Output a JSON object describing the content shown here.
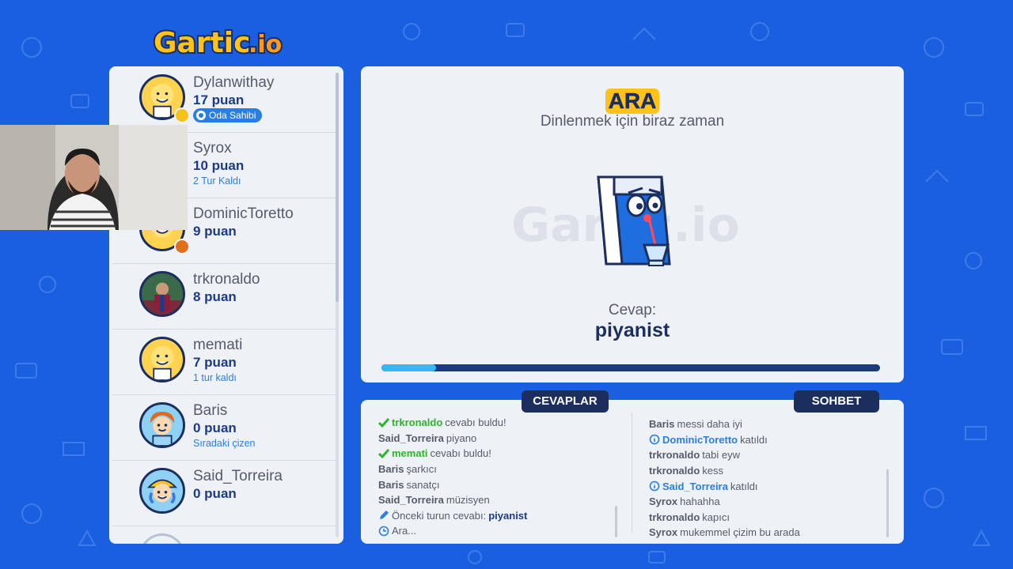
{
  "logo_text": "Gartic.io",
  "players": [
    {
      "name": "Dylanwithay",
      "points": "17 puan",
      "badge": "Oda Sahibi",
      "status_color": "#f6c21b"
    },
    {
      "name": "Syrox",
      "points": "10 puan",
      "sub": "2 Tur Kaldı"
    },
    {
      "name": "DominicToretto",
      "points": "9 puan",
      "status_color": "#e0701c"
    },
    {
      "name": "trkronaldo",
      "points": "8 puan"
    },
    {
      "name": "memati",
      "points": "7 puan",
      "sub": "1 tur kaldı"
    },
    {
      "name": "Baris",
      "points": "0 puan",
      "sub": "Sıradaki çizen"
    },
    {
      "name": "Said_Torreira",
      "points": "0 puan"
    }
  ],
  "stage": {
    "title": "ARA",
    "subtitle": "Dinlenmek için biraz zaman",
    "answer_label": "Cevap:",
    "answer": "piyanist",
    "progress": 0.11,
    "colors": {
      "accent": "#ffc21a",
      "progress_fill": "#39b8f0",
      "progress_track": "#1b3a7a"
    }
  },
  "tabs": {
    "answers": "CEVAPLAR",
    "chat": "SOHBET"
  },
  "answers": [
    {
      "user": "trkronaldo",
      "text": "cevabı buldu!",
      "type": "correct"
    },
    {
      "user": "Said_Torreira",
      "text": "piyano",
      "type": "guess"
    },
    {
      "user": "memati",
      "text": "cevabı buldu!",
      "type": "correct"
    },
    {
      "user": "Baris",
      "text": "şarkıcı",
      "type": "guess"
    },
    {
      "user": "Baris",
      "text": "sanatçı",
      "type": "guess"
    },
    {
      "user": "Said_Torreira",
      "text": "müzisyen",
      "type": "guess"
    },
    {
      "prefix": "Önceki turun cevabı:",
      "value": "piyanist",
      "type": "previous"
    },
    {
      "text": "Ara...",
      "type": "info"
    }
  ],
  "chat": [
    {
      "user": "Baris",
      "text": "messi daha iyi",
      "type": "msg"
    },
    {
      "user": "DominicToretto",
      "text": "katıldı",
      "type": "join"
    },
    {
      "user": "trkronaldo",
      "text": "tabi eyw",
      "type": "msg"
    },
    {
      "user": "trkronaldo",
      "text": "kess",
      "type": "msg"
    },
    {
      "user": "Said_Torreira",
      "text": "katıldı",
      "type": "join"
    },
    {
      "user": "Syrox",
      "text": "hahahha",
      "type": "msg"
    },
    {
      "user": "trkronaldo",
      "text": "kapıcı",
      "type": "msg"
    },
    {
      "user": "Syrox",
      "text": "mukemmel çizim bu arada",
      "type": "msg"
    }
  ]
}
